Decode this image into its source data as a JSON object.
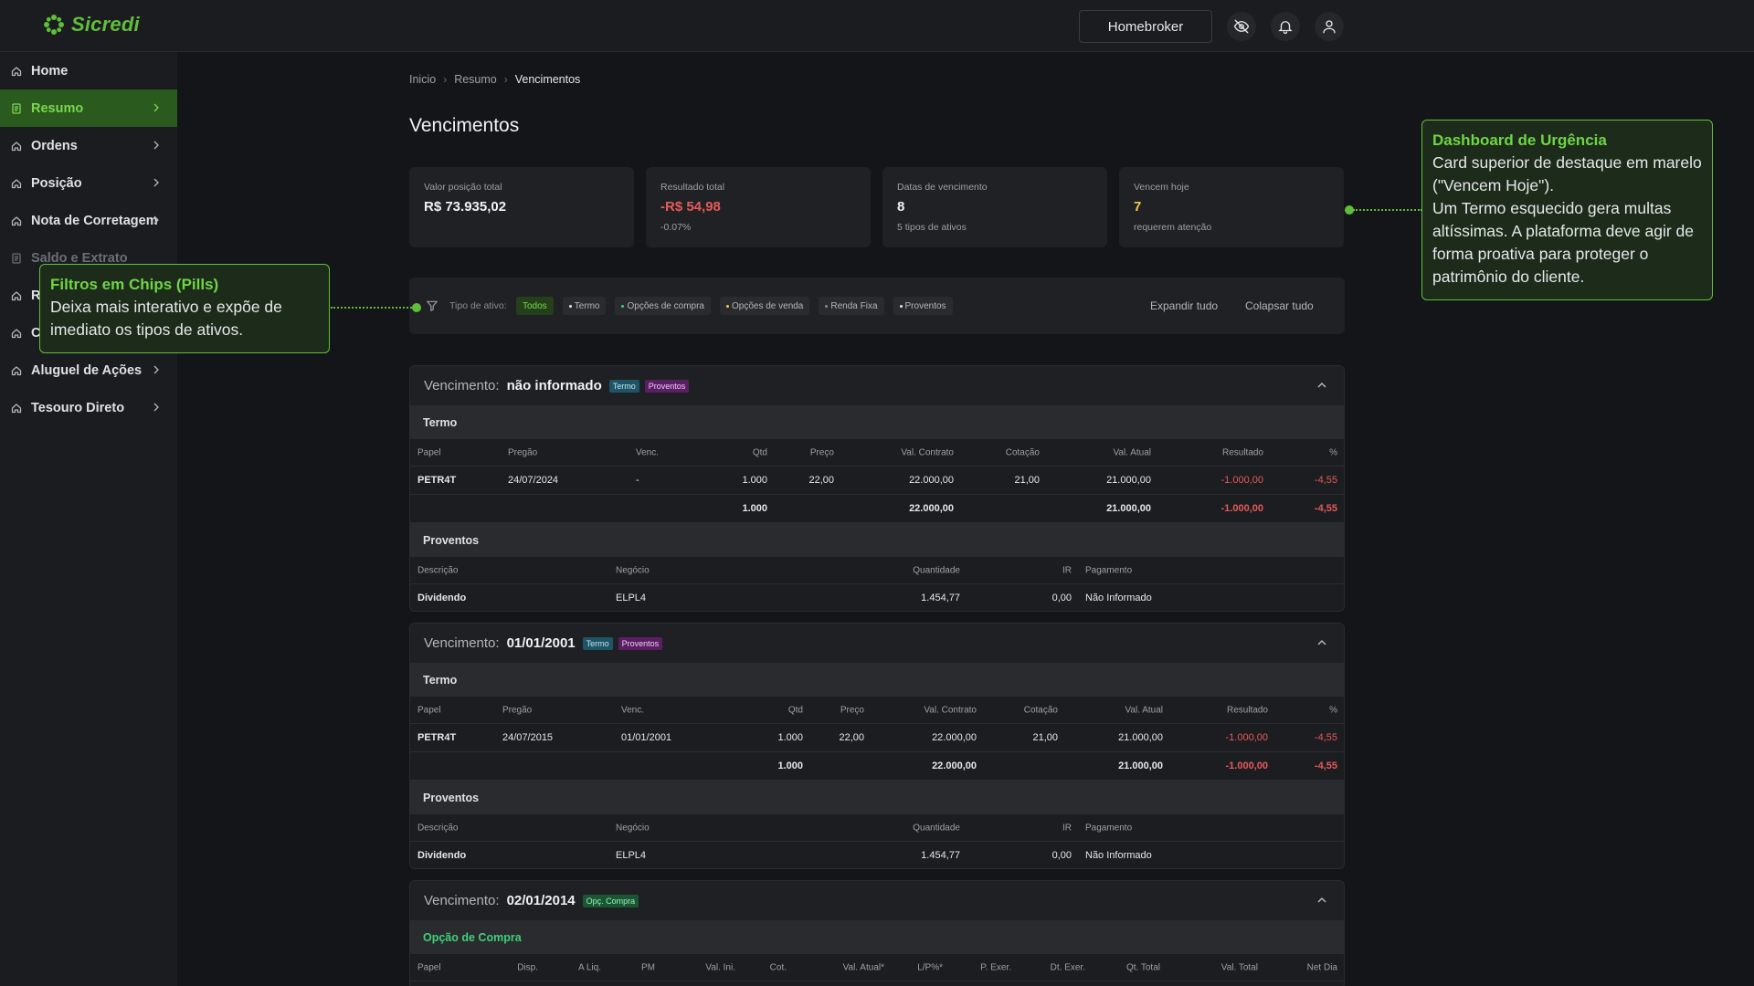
{
  "header": {
    "logo_text": "Sicredi",
    "homebroker_label": "Homebroker",
    "icons": [
      "eye-off-icon",
      "bell-icon",
      "user-icon"
    ]
  },
  "sidebar": {
    "items": [
      {
        "label": "Home",
        "icon": "home-icon"
      },
      {
        "label": "Resumo",
        "icon": "document-icon",
        "active": true
      },
      {
        "label": "Ordens",
        "icon": "home-icon"
      },
      {
        "label": "Posição",
        "icon": "home-icon"
      },
      {
        "label": "Nota de Corretagem",
        "icon": "home-icon"
      },
      {
        "label": "Saldo e Extrato",
        "icon": "document-icon"
      },
      {
        "label": "R",
        "icon": "home-icon"
      },
      {
        "label": "C",
        "icon": "home-icon"
      },
      {
        "label": "Aluguel de Ações",
        "icon": "home-icon"
      },
      {
        "label": "Tesouro Direto",
        "icon": "home-icon"
      }
    ]
  },
  "breadcrumb": [
    "Inicio",
    "Resumo",
    "Vencimentos"
  ],
  "page_title": "Vencimentos",
  "stats": [
    {
      "label": "Valor posição total",
      "value": "R$ 73.935,02",
      "sub": ""
    },
    {
      "label": "Resultado total",
      "value": "-R$ 54,98",
      "sub": "-0.07%"
    },
    {
      "label": "Datas de vencimento",
      "value": "8",
      "sub": "5 tipos de ativos"
    },
    {
      "label": "Vencem hoje",
      "value": "7",
      "sub": "requerem atenção"
    }
  ],
  "filters": {
    "label": "Tipo de ativo:",
    "chips": [
      "Todos",
      "Termo",
      "Opções de compra",
      "Opções de venda",
      "Renda Fixa",
      "Proventos"
    ],
    "chip_dot_colors": [
      "",
      "#e6e7ea",
      "#3fd07a",
      "#f2c94c",
      "#8a8d93",
      "#e6e7ea"
    ],
    "expand_label": "Expandir tudo",
    "collapse_label": "Colapsar tudo"
  },
  "callouts": {
    "filters": {
      "title": "Filtros em Chips (Pills)",
      "body": "Deixa mais interativo e expõe de imediato os tipos de ativos."
    },
    "urgency": {
      "title": "Dashboard de Urgência",
      "body_1": "Card superior de destaque em marelo (\"Vencem Hoje\").",
      "body_2": "Um Termo esquecido gera multas altíssimas. A plataforma deve agir de forma proativa para proteger o patrimônio do cliente."
    }
  },
  "groups": [
    {
      "label": "Vencimento:",
      "date": "não informado",
      "tags": [
        "Termo",
        "Proventos"
      ],
      "termo": {
        "title": "Termo",
        "columns": [
          "Papel",
          "Pregão",
          "Venc.",
          "Qtd",
          "Preço",
          "Val. Contrato",
          "Cotação",
          "Val. Atual",
          "Resultado",
          "%"
        ],
        "row": [
          "PETR4T",
          "24/07/2024",
          "-",
          "1.000",
          "22,00",
          "22.000,00",
          "21,00",
          "21.000,00",
          "-1.000,00",
          "-4,55"
        ],
        "total": [
          "1.000",
          "22.000,00",
          "21.000,00",
          "-1.000,00",
          "-4,55"
        ]
      },
      "proventos": {
        "title": "Proventos",
        "columns": [
          "Descrição",
          "Negócio",
          "Quantidade",
          "IR",
          "Pagamento"
        ],
        "row": [
          "Dividendo",
          "ELPL4",
          "1.454,77",
          "0,00",
          "Não Informado"
        ]
      }
    },
    {
      "label": "Vencimento:",
      "date": "01/01/2001",
      "tags": [
        "Termo",
        "Proventos"
      ],
      "termo": {
        "title": "Termo",
        "columns": [
          "Papel",
          "Pregão",
          "Venc.",
          "Qtd",
          "Preço",
          "Val. Contrato",
          "Cotação",
          "Val. Atual",
          "Resultado",
          "%"
        ],
        "row": [
          "PETR4T",
          "24/07/2015",
          "01/01/2001",
          "1.000",
          "22,00",
          "22.000,00",
          "21,00",
          "21.000,00",
          "-1.000,00",
          "-4,55"
        ],
        "total": [
          "1.000",
          "22.000,00",
          "21.000,00",
          "-1.000,00",
          "-4,55"
        ]
      },
      "proventos": {
        "title": "Proventos",
        "columns": [
          "Descrição",
          "Negócio",
          "Quantidade",
          "IR",
          "Pagamento"
        ],
        "row": [
          "Dividendo",
          "ELPL4",
          "1.454,77",
          "0,00",
          "Não Informado"
        ]
      }
    },
    {
      "label": "Vencimento:",
      "date": "02/01/2014",
      "tags": [
        "Opç. Compra"
      ],
      "opcao": {
        "title": "Opção de Compra",
        "columns": [
          "Papel",
          "Disp.",
          "A Liq.",
          "PM",
          "Val. Ini.",
          "Cot.",
          "Val. Atual*",
          "L/P%*",
          "P. Exer.",
          "Dt. Exer.",
          "Qt. Total",
          "Val. Total",
          "Net Dia"
        ]
      }
    }
  ],
  "colors": {
    "accent": "#5fbf3a",
    "negative": "#e55a5a",
    "warning": "#f2c94c"
  }
}
